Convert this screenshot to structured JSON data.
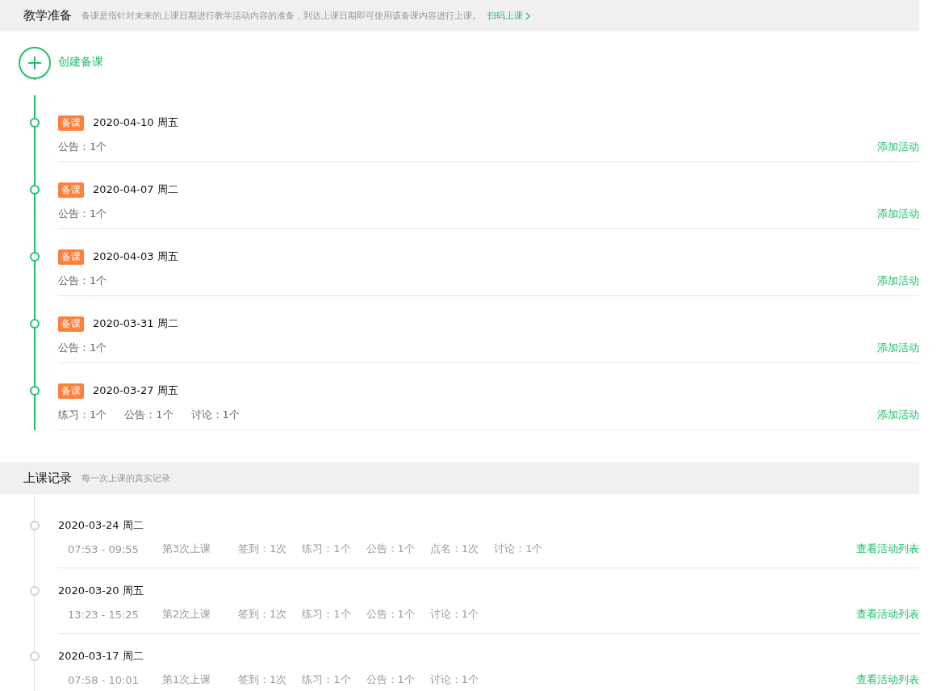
{
  "prep_section": {
    "title": "教学准备",
    "description": "备课是指针对未来的上课日期进行教学活动内容的准备，到达上课日期即可使用该备课内容进行上课。",
    "link": "扫码上课"
  },
  "create_button": {
    "label": "创建备课"
  },
  "prep_items": [
    {
      "tag": "备课",
      "date": "2020-04-10 周五",
      "stats": [
        "公告：1个"
      ],
      "action": "添加活动"
    },
    {
      "tag": "备课",
      "date": "2020-04-07 周二",
      "stats": [
        "公告：1个"
      ],
      "action": "添加活动"
    },
    {
      "tag": "备课",
      "date": "2020-04-03 周五",
      "stats": [
        "公告：1个"
      ],
      "action": "添加活动"
    },
    {
      "tag": "备课",
      "date": "2020-03-31 周二",
      "stats": [
        "公告：1个"
      ],
      "action": "添加活动"
    },
    {
      "tag": "备课",
      "date": "2020-03-27 周五",
      "stats": [
        "练习：1个",
        "公告：1个",
        "讨论：1个"
      ],
      "action": "添加活动"
    }
  ],
  "record_section": {
    "title": "上课记录",
    "description": "每一次上课的真实记录"
  },
  "records": [
    {
      "date": "2020-03-24 周二",
      "time": "07:53 - 09:55",
      "session": "第3次上课",
      "stats": [
        "签到：1次",
        "练习：1个",
        "公告：1个",
        "点名：1次",
        "讨论：1个"
      ],
      "action": "查看活动列表"
    },
    {
      "date": "2020-03-20 周五",
      "time": "13:23 - 15:25",
      "session": "第2次上课",
      "stats": [
        "签到：1次",
        "练习：1个",
        "公告：1个",
        "讨论：1个"
      ],
      "action": "查看活动列表"
    },
    {
      "date": "2020-03-17 周二",
      "time": "07:58 - 10:01",
      "session": "第1次上课",
      "stats": [
        "签到：1次",
        "练习：1个",
        "公告：1个",
        "讨论：1个"
      ],
      "action": "查看活动列表"
    }
  ]
}
